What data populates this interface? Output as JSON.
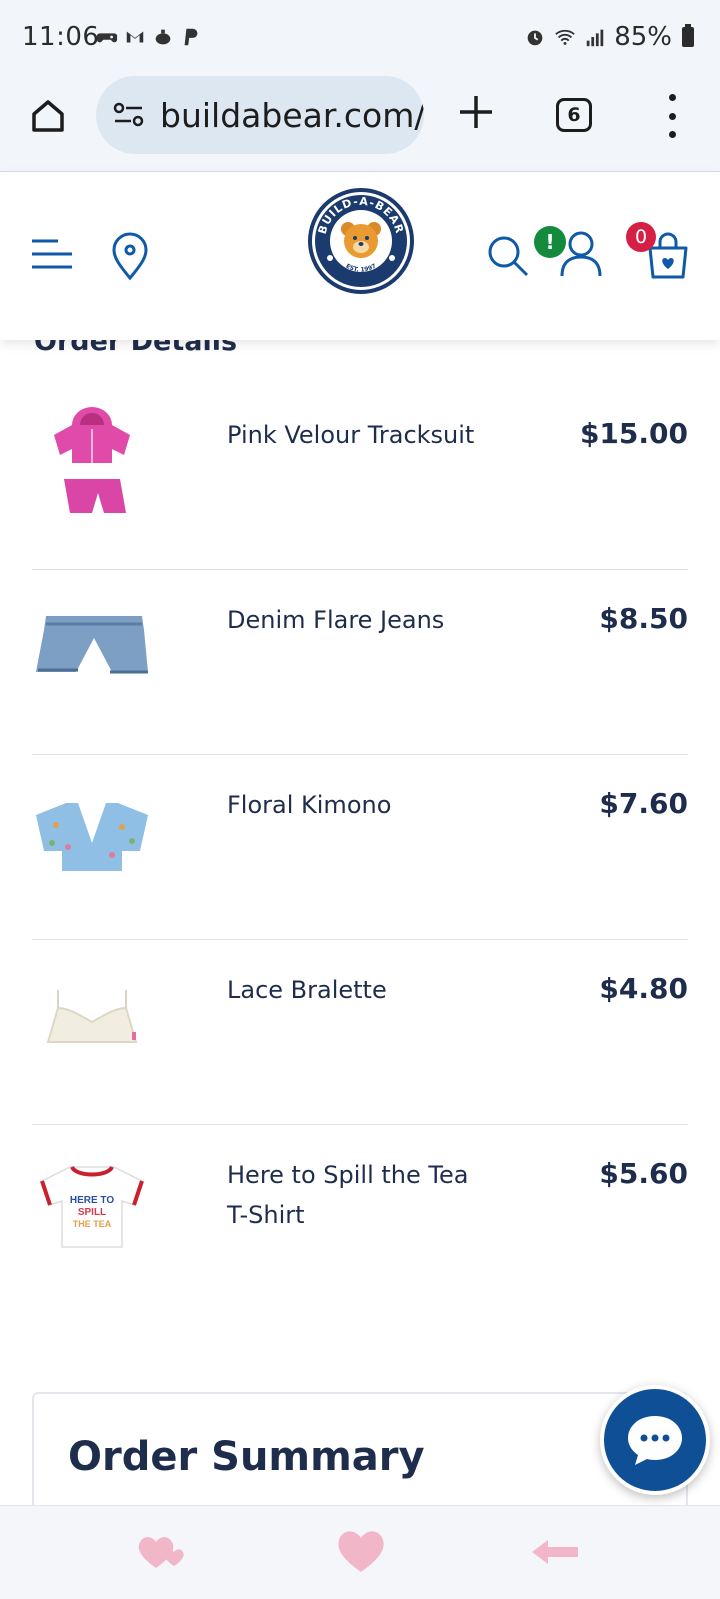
{
  "status_bar": {
    "time": "11:06",
    "battery": "85%",
    "notification_icons": [
      "game-controller-icon",
      "gmail-icon",
      "teapot-icon",
      "paypal-icon"
    ],
    "system_icons": [
      "alarm-icon",
      "wifi-icon",
      "signal-icon",
      "battery-icon"
    ]
  },
  "browser": {
    "url": "buildabear.com/",
    "tab_count": "6"
  },
  "header": {
    "logo_text": "BUILD-A-BEAR",
    "logo_est": "EST. 1997",
    "account_badge": "!",
    "cart_count": "0",
    "colors": {
      "brand_navy": "#1b3a6e",
      "brand_blue": "#0f5aa8",
      "badge_green": "#138a3c",
      "badge_red": "#d61f45"
    }
  },
  "order_details": {
    "title": "Order Details",
    "items": [
      {
        "name": "Pink Velour Tracksuit",
        "price": "$15.00",
        "thumb": "pink-tracksuit-image"
      },
      {
        "name": "Denim Flare Jeans",
        "price": "$8.50",
        "thumb": "denim-jeans-image"
      },
      {
        "name": "Floral Kimono",
        "price": "$7.60",
        "thumb": "floral-kimono-image"
      },
      {
        "name": "Lace Bralette",
        "price": "$4.80",
        "thumb": "lace-bralette-image"
      },
      {
        "name": "Here to Spill the Tea T-Shirt",
        "price": "$5.60",
        "thumb": "tea-tshirt-image",
        "shirt_text": [
          "HERE TO",
          "SPILL",
          "THE TEA"
        ]
      }
    ]
  },
  "order_summary": {
    "title": "Order Summary"
  },
  "bottom_bar": {
    "icons": [
      "hearts-icon",
      "heart-icon",
      "back-arrow-icon"
    ]
  }
}
